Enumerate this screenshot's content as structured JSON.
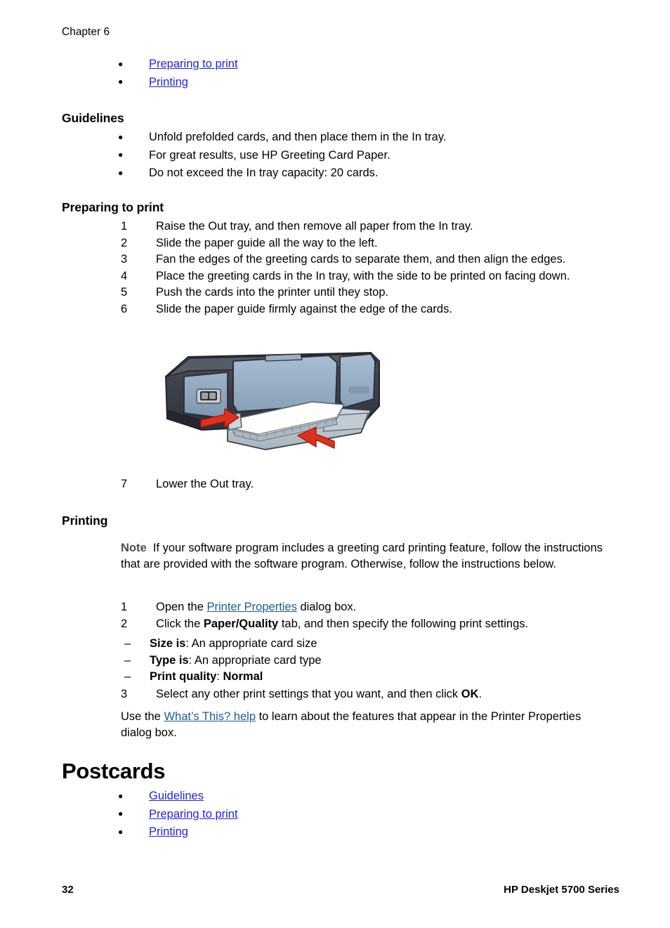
{
  "page": {
    "chapter_label": "Chapter 6",
    "footer_page_number": "32",
    "footer_product": "HP Deskjet 5700 Series"
  },
  "colors": {
    "link_blue": "#2222dd",
    "link_blue_dark": "#1f5c8f",
    "note_label_gray": "#4d4d4d",
    "printer_body_dark": "#3a3d45",
    "printer_panel_blue": "#8ba3bd",
    "arrow_red": "#e0301e",
    "paper_white": "#fdfdfd",
    "tray_gray": "#b9c4cc"
  },
  "top_links": {
    "items": [
      {
        "label": "Preparing to print"
      },
      {
        "label": "Printing"
      }
    ]
  },
  "guidelines": {
    "heading": "Guidelines",
    "items": [
      {
        "text": "Unfold prefolded cards, and then place them in the In tray."
      },
      {
        "text": "For great results, use HP Greeting Card Paper."
      },
      {
        "text": "Do not exceed the In tray capacity: 20 cards."
      }
    ]
  },
  "preparing_to_print": {
    "heading": "Preparing to print",
    "steps": [
      {
        "num": "1",
        "text": "Raise the Out tray, and then remove all paper from the In tray."
      },
      {
        "num": "2",
        "text": "Slide the paper guide all the way to the left."
      },
      {
        "num": "3",
        "text": "Fan the edges of the greeting cards to separate them, and then align the edges."
      },
      {
        "num": "4",
        "text": "Place the greeting cards in the In tray, with the side to be printed on facing down."
      },
      {
        "num": "5",
        "text": "Push the cards into the printer until they stop."
      },
      {
        "num": "6",
        "text": "Slide the paper guide firmly against the edge of the cards."
      }
    ],
    "step_after_figure": {
      "num": "7",
      "text": "Lower the Out tray."
    }
  },
  "figure": {
    "alt": "Printer with In tray loaded with greeting cards and two red arrows showing paper guide direction",
    "arrow_left_name": "paper-guide-arrow-left",
    "arrow_right_name": "paper-push-arrow-right"
  },
  "printing": {
    "heading": "Printing",
    "note_label": "Note",
    "note_text": "If your software program includes a greeting card printing feature, follow the instructions that are provided with the software program. Otherwise, follow the instructions below.",
    "step1": {
      "num": "1",
      "before": "Open the ",
      "link": "Printer Properties",
      "after": " dialog box."
    },
    "step2": {
      "num": "2",
      "before": "Click the ",
      "bold": "Paper/Quality",
      "after": " tab, and then specify the following print settings."
    },
    "settings": [
      {
        "label": "Size is",
        "sep": ": ",
        "value": "An appropriate card size",
        "value_bold": false
      },
      {
        "label": "Type is",
        "sep": ": ",
        "value": "An appropriate card type",
        "value_bold": false
      },
      {
        "label": "Print quality",
        "sep": ": ",
        "value": "Normal",
        "value_bold": true
      }
    ],
    "step3": {
      "num": "3",
      "before": "Select any other print settings that you want, and then click ",
      "bold": "OK",
      "after": "."
    },
    "help_paragraph": {
      "before": "Use the ",
      "link": "What’s This? help",
      "after": " to learn about the features that appear in the Printer Properties dialog box."
    }
  },
  "postcards": {
    "heading": "Postcards",
    "items": [
      {
        "label": "Guidelines"
      },
      {
        "label": "Preparing to print"
      },
      {
        "label": "Printing"
      }
    ]
  }
}
